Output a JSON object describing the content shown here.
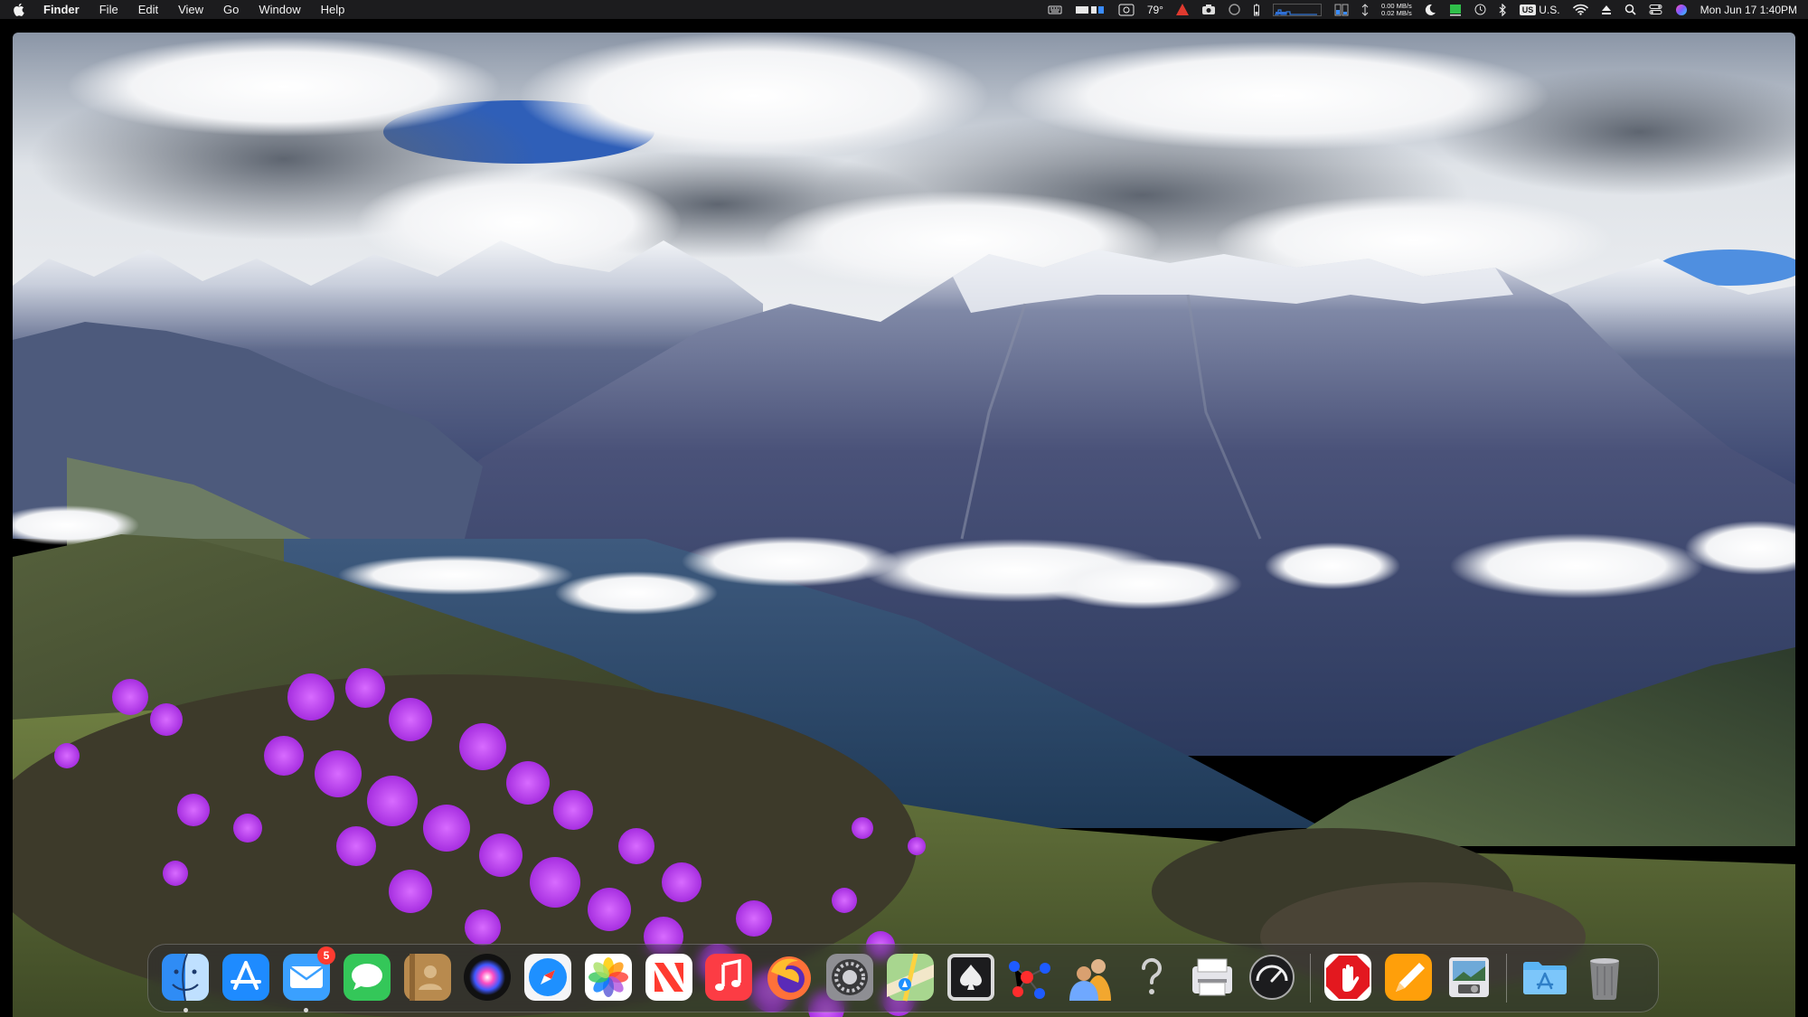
{
  "menubar": {
    "app_name": "Finder",
    "menus": [
      "File",
      "Edit",
      "View",
      "Go",
      "Window",
      "Help"
    ],
    "weather": "79°",
    "net_up": "0.00 MB/s",
    "net_down": "0.02 MB/s",
    "keyboard_badge": "US",
    "keyboard_label": "U.S.",
    "clock": "Mon Jun 17  1:40PM",
    "icons": [
      "keyboard-icon",
      "display-icon",
      "screenshot-icon",
      "alert-icon",
      "camera-icon",
      "circle-icon",
      "battery-icon",
      "cpu-graph-icon",
      "memory-icon",
      "network-icon",
      "moon-icon",
      "green-status-icon",
      "clock-icon",
      "bluetooth-icon",
      "wifi-icon",
      "eject-icon",
      "search-icon",
      "control-center-icon",
      "siri-icon"
    ]
  },
  "colors": {
    "menubar_bg": "#1c1c1e",
    "dock_bg": "rgba(40,40,48,0.38)",
    "badge": "#ff3b30"
  },
  "dock": {
    "apps": [
      {
        "name": "finder-icon",
        "running": true
      },
      {
        "name": "app-store-icon",
        "running": false
      },
      {
        "name": "mail-icon",
        "running": true,
        "badge": "5"
      },
      {
        "name": "messages-icon",
        "running": false
      },
      {
        "name": "contacts-icon",
        "running": false
      },
      {
        "name": "siri-icon",
        "running": false
      },
      {
        "name": "safari-icon",
        "running": false
      },
      {
        "name": "photos-icon",
        "running": false
      },
      {
        "name": "news-icon",
        "running": false
      },
      {
        "name": "music-icon",
        "running": false
      },
      {
        "name": "firefox-icon",
        "running": false
      },
      {
        "name": "system-preferences-icon",
        "running": false
      },
      {
        "name": "maps-icon",
        "running": false
      },
      {
        "name": "solitaire-icon",
        "running": false
      },
      {
        "name": "molecule-app-icon",
        "running": false
      },
      {
        "name": "directory-utility-icon",
        "running": false
      },
      {
        "name": "help-icon",
        "running": false
      },
      {
        "name": "printer-icon",
        "running": false
      },
      {
        "name": "activity-monitor-icon",
        "running": false
      },
      {
        "name": "stop-hand-icon",
        "running": false
      },
      {
        "name": "pages-icon",
        "running": false
      },
      {
        "name": "preview-icon",
        "running": false
      },
      {
        "name": "applications-folder-icon",
        "running": false
      },
      {
        "name": "trash-icon",
        "running": false
      }
    ]
  }
}
